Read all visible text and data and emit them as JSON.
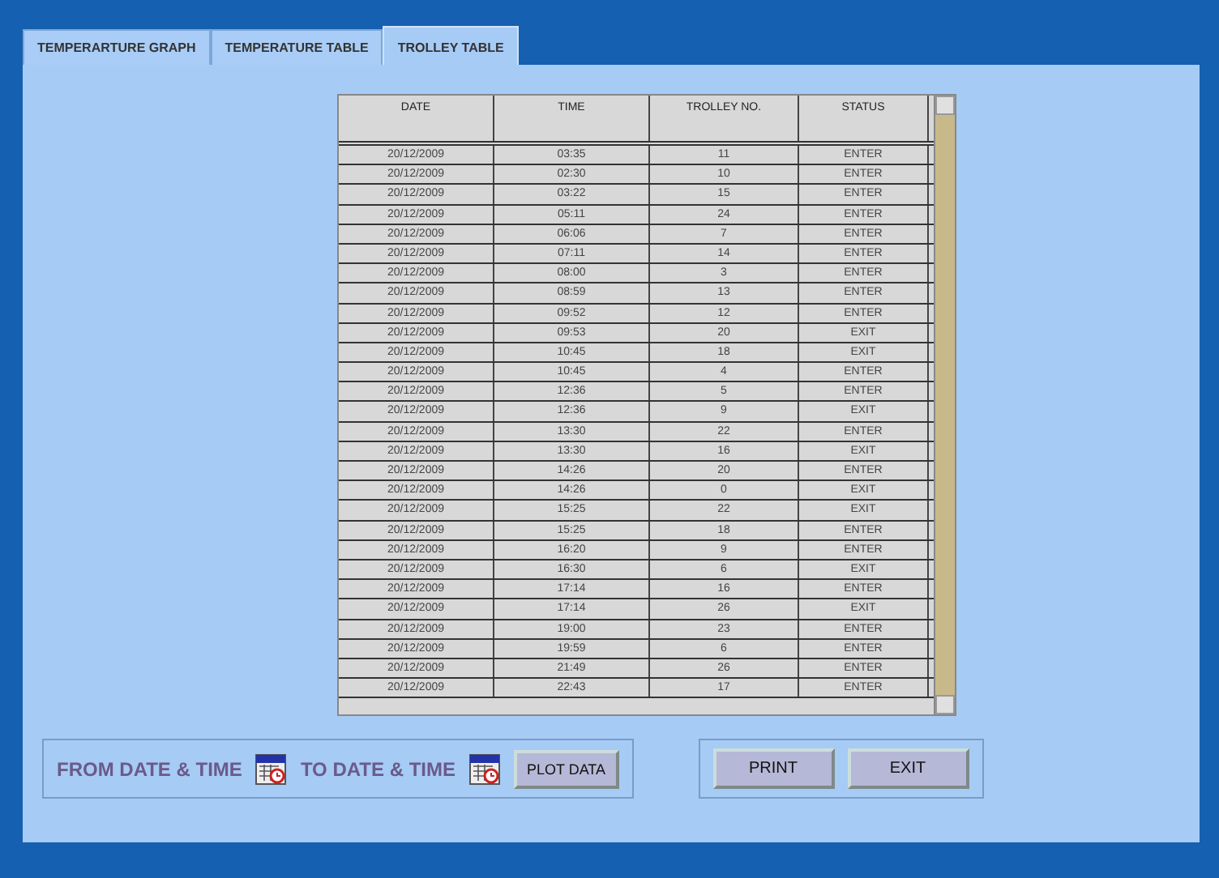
{
  "tabs": [
    {
      "label": "TEMPERARTURE GRAPH",
      "selected": false
    },
    {
      "label": "TEMPERATURE TABLE",
      "selected": false
    },
    {
      "label": "TROLLEY TABLE",
      "selected": true
    }
  ],
  "table": {
    "columns": [
      "DATE",
      "TIME",
      "TROLLEY NO.",
      "STATUS"
    ],
    "rows": [
      [
        "20/12/2009",
        "03:35",
        "11",
        "ENTER"
      ],
      [
        "20/12/2009",
        "02:30",
        "10",
        "ENTER"
      ],
      [
        "20/12/2009",
        "03:22",
        "15",
        "ENTER"
      ],
      [
        "20/12/2009",
        "05:11",
        "24",
        "ENTER"
      ],
      [
        "20/12/2009",
        "06:06",
        "7",
        "ENTER"
      ],
      [
        "20/12/2009",
        "07:11",
        "14",
        "ENTER"
      ],
      [
        "20/12/2009",
        "08:00",
        "3",
        "ENTER"
      ],
      [
        "20/12/2009",
        "08:59",
        "13",
        "ENTER"
      ],
      [
        "20/12/2009",
        "09:52",
        "12",
        "ENTER"
      ],
      [
        "20/12/2009",
        "09:53",
        "20",
        "EXIT"
      ],
      [
        "20/12/2009",
        "10:45",
        "18",
        "EXIT"
      ],
      [
        "20/12/2009",
        "10:45",
        "4",
        "ENTER"
      ],
      [
        "20/12/2009",
        "12:36",
        "5",
        "ENTER"
      ],
      [
        "20/12/2009",
        "12:36",
        "9",
        "EXIT"
      ],
      [
        "20/12/2009",
        "13:30",
        "22",
        "ENTER"
      ],
      [
        "20/12/2009",
        "13:30",
        "16",
        "EXIT"
      ],
      [
        "20/12/2009",
        "14:26",
        "20",
        "ENTER"
      ],
      [
        "20/12/2009",
        "14:26",
        "0",
        "EXIT"
      ],
      [
        "20/12/2009",
        "15:25",
        "22",
        "EXIT"
      ],
      [
        "20/12/2009",
        "15:25",
        "18",
        "ENTER"
      ],
      [
        "20/12/2009",
        "16:20",
        "9",
        "ENTER"
      ],
      [
        "20/12/2009",
        "16:30",
        "6",
        "EXIT"
      ],
      [
        "20/12/2009",
        "17:14",
        "16",
        "ENTER"
      ],
      [
        "20/12/2009",
        "17:14",
        "26",
        "EXIT"
      ],
      [
        "20/12/2009",
        "19:00",
        "23",
        "ENTER"
      ],
      [
        "20/12/2009",
        "19:59",
        "6",
        "ENTER"
      ],
      [
        "20/12/2009",
        "21:49",
        "26",
        "ENTER"
      ],
      [
        "20/12/2009",
        "22:43",
        "17",
        "ENTER"
      ]
    ]
  },
  "range": {
    "from_label": "FROM DATE & TIME",
    "to_label": "TO DATE & TIME",
    "plot_button": "PLOT DATA"
  },
  "buttons": [
    "PRINT",
    "EXIT"
  ]
}
